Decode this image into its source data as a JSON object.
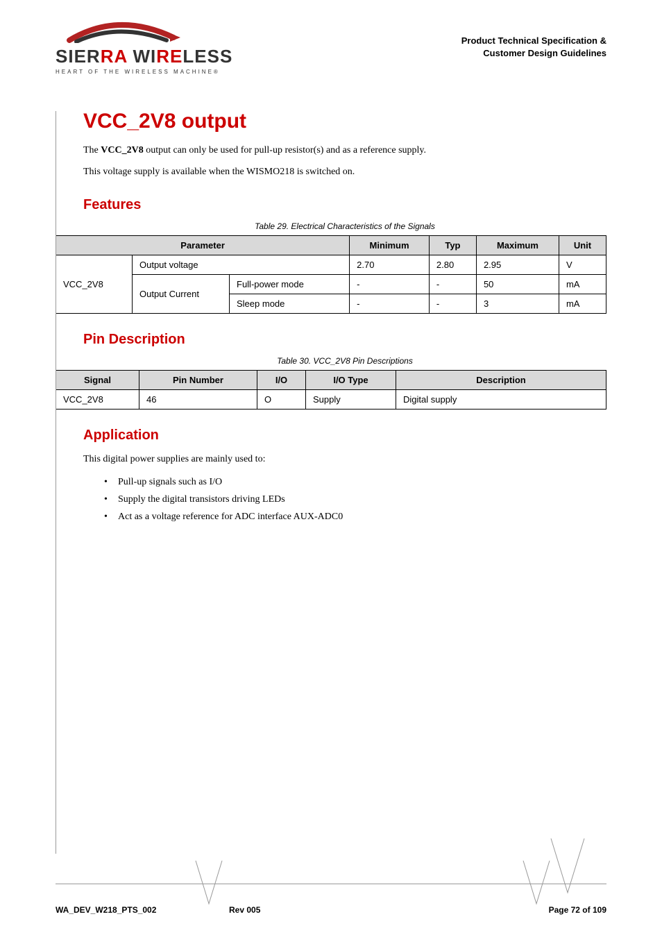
{
  "header": {
    "logo_line1a": "SIER",
    "logo_line1b": "RA",
    "logo_line1c": " WI",
    "logo_line1d": "RE",
    "logo_line1e": "LESS",
    "logo_tag": "HEART OF THE WIRELESS MACHINE®",
    "right_line1": "Product Technical Specification &",
    "right_line2": "Customer Design Guidelines"
  },
  "title": "VCC_2V8 output",
  "intro1a": "The ",
  "intro1b": "VCC_2V8",
  "intro1c": " output can only be used for pull-up resistor(s) and as a reference supply.",
  "intro2": "This voltage supply is available when the WISMO218 is switched on.",
  "features_heading": "Features",
  "table29_caption": "Table 29.    Electrical Characteristics of the Signals",
  "t29": {
    "h_parameter": "Parameter",
    "h_min": "Minimum",
    "h_typ": "Typ",
    "h_max": "Maximum",
    "h_unit": "Unit",
    "row_group": "VCC_2V8",
    "r1_label": "Output voltage",
    "r1_min": "2.70",
    "r1_typ": "2.80",
    "r1_max": "2.95",
    "r1_unit": "V",
    "r2_group": "Output Current",
    "r2_label": "Full-power mode",
    "r2_min": "-",
    "r2_typ": "-",
    "r2_max": "50",
    "r2_unit": "mA",
    "r3_label": "Sleep mode",
    "r3_min": "-",
    "r3_typ": "-",
    "r3_max": "3",
    "r3_unit": "mA"
  },
  "pindesc_heading": "Pin Description",
  "table30_caption": "Table 30.    VCC_2V8 Pin Descriptions",
  "t30": {
    "h_signal": "Signal",
    "h_pin": "Pin Number",
    "h_io": "I/O",
    "h_iotype": "I/O Type",
    "h_desc": "Description",
    "r1_signal": "VCC_2V8",
    "r1_pin": "46",
    "r1_io": "O",
    "r1_iotype": "Supply",
    "r1_desc": "Digital supply"
  },
  "app_heading": "Application",
  "app_intro": "This digital power supplies are mainly used to:",
  "bullets": {
    "b1": "Pull-up signals such as I/O",
    "b2": "Supply the digital transistors driving LEDs",
    "b3": "Act as a voltage reference for ADC interface AUX-ADC0"
  },
  "footer": {
    "left": "WA_DEV_W218_PTS_002",
    "center": "Rev 005",
    "right": "Page 72 of 109"
  }
}
